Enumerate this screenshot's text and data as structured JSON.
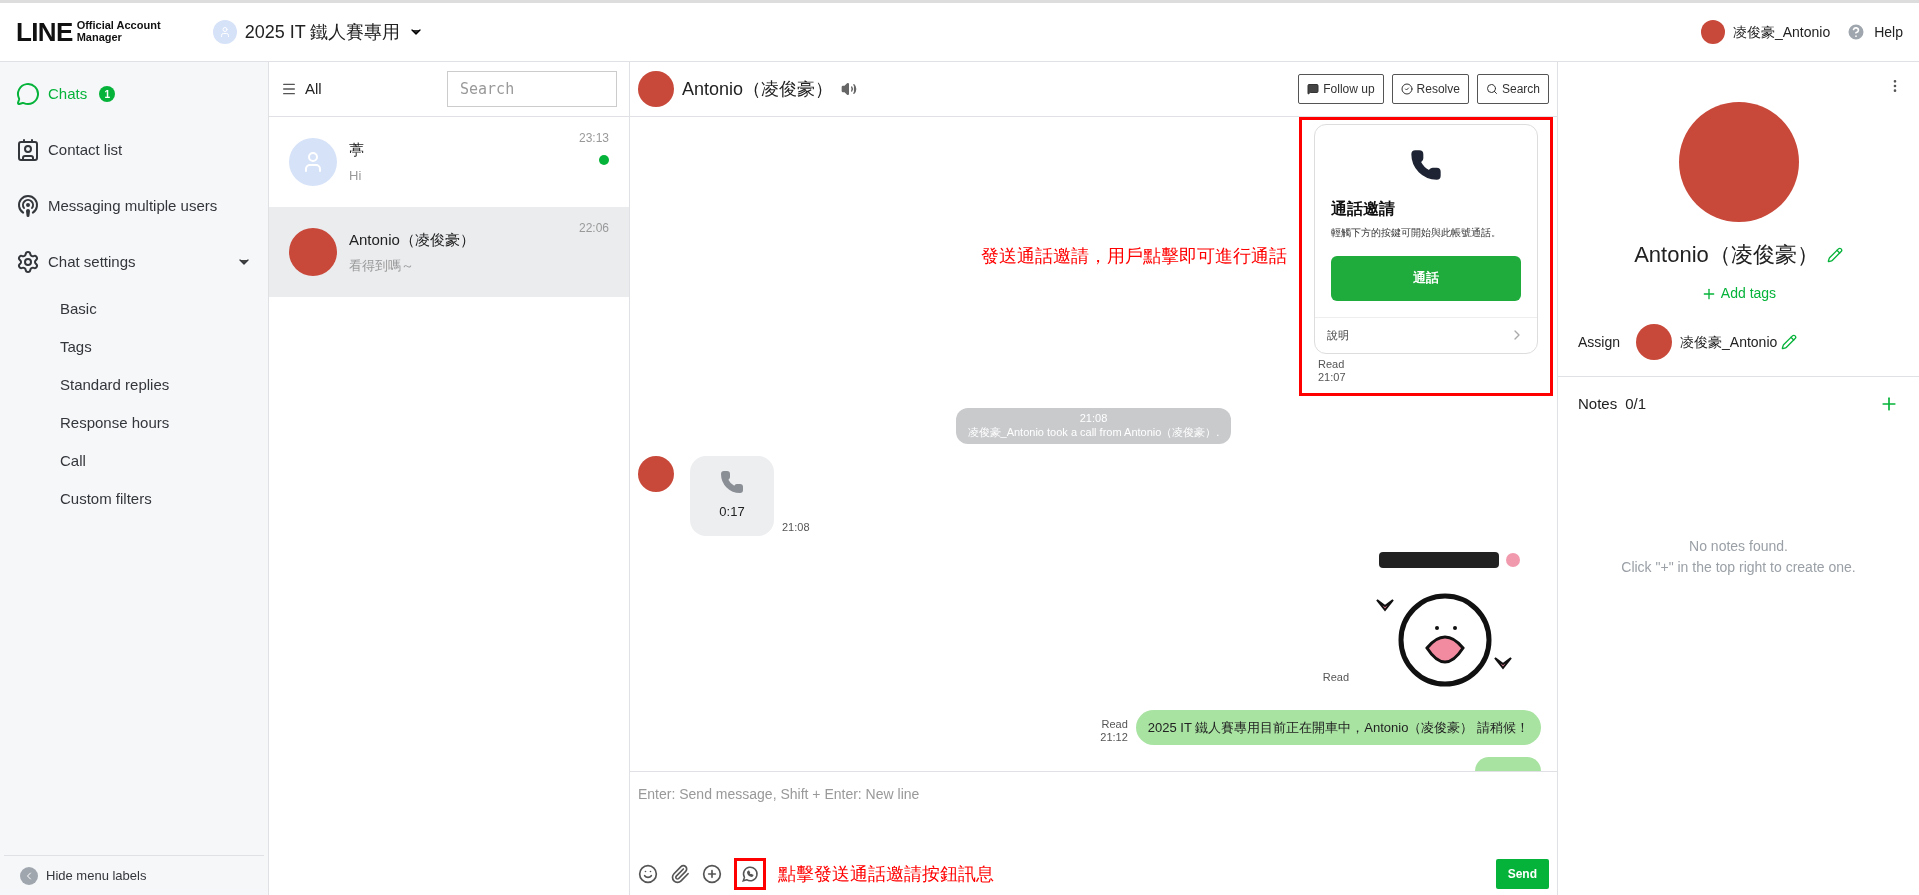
{
  "header": {
    "logo_main": "LINE",
    "logo_sub": "Official Account Manager",
    "account": "2025 IT 鐵人賽專用",
    "user": "凌俊豪_Antonio",
    "help": "Help"
  },
  "sidebar": {
    "items": [
      {
        "kind": "chats",
        "label": "Chats",
        "badge": "1",
        "selected": true
      },
      {
        "kind": "contacts",
        "label": "Contact list",
        "selected": false
      },
      {
        "kind": "broadcast",
        "label": "Messaging multiple users",
        "selected": false
      },
      {
        "kind": "settings",
        "label": "Chat settings",
        "selected": false,
        "expanded": true,
        "children": [
          {
            "label": "Basic"
          },
          {
            "label": "Tags"
          },
          {
            "label": "Standard replies"
          },
          {
            "label": "Response hours"
          },
          {
            "label": "Call"
          },
          {
            "label": "Custom filters"
          }
        ]
      }
    ],
    "footer": "Hide menu labels"
  },
  "chat_list": {
    "filter": "All",
    "search": {
      "placeholder": "Search"
    },
    "items": [
      {
        "has_photo": false,
        "name": "葶",
        "preview": "Hi",
        "time": "23:13",
        "unread": true,
        "selected": false
      },
      {
        "has_photo": true,
        "name": "Antonio（凌俊豪）",
        "preview": "看得到嗎～",
        "time": "22:06",
        "unread": false,
        "selected": true
      }
    ]
  },
  "chat": {
    "title": "Antonio（凌俊豪）",
    "buttons": [
      {
        "kind": "follow",
        "label": "Follow up"
      },
      {
        "kind": "resolve",
        "label": "Resolve"
      },
      {
        "kind": "search",
        "label": "Search"
      }
    ],
    "messages": [
      {
        "kind": "call_invite",
        "title": "通話邀請",
        "body": "輕觸下方的按鍵可開始與此帳號通話。",
        "button": "通話",
        "link": "說明",
        "status": "Read",
        "time": "21:07",
        "annotation": "發送通話邀請，用戶點擊即可進行通話"
      },
      {
        "kind": "system",
        "time": "21:08",
        "text": "凌俊豪_Antonio took a call from Antonio（凌俊豪）."
      },
      {
        "kind": "call_log",
        "duration": "0:17",
        "time": "21:08"
      },
      {
        "kind": "sticker",
        "status": "Read"
      },
      {
        "kind": "text",
        "text": "2025 IT 鐵人賽專用目前正在開車中，Antonio（凌俊豪） 請稍候！",
        "status": "Read",
        "time": "21:12"
      },
      {
        "kind": "clipped"
      }
    ],
    "composer": {
      "placeholder": "Enter: Send message, Shift + Enter: New line",
      "annotation": "點擊發送通話邀請按鈕訊息",
      "send": "Send"
    }
  },
  "profile": {
    "name": "Antonio（凌俊豪）",
    "add_tags": "Add tags",
    "assign_label": "Assign",
    "assignee": "凌俊豪_Antonio",
    "notes_title": "Notes",
    "notes_count": "0/1",
    "empty_line1": "No notes found.",
    "empty_line2": "Click \"+\" in the top right to create one."
  }
}
